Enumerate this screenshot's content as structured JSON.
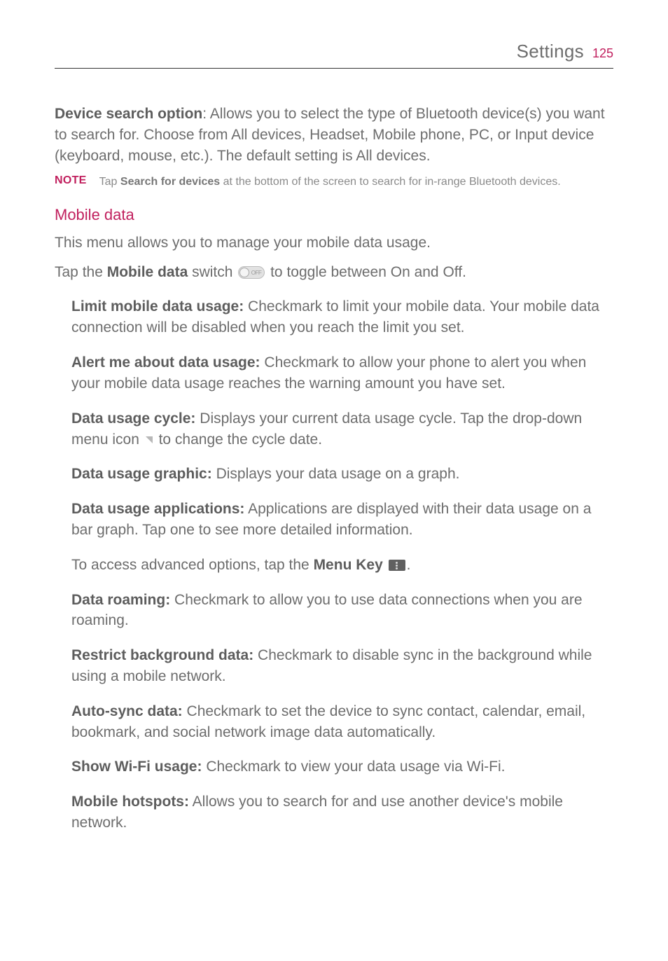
{
  "header": {
    "title": "Settings",
    "page": "125"
  },
  "p1": {
    "bold": "Device search option",
    "text": ": Allows you to select the type of Bluetooth device(s) you want to search for. Choose from All devices, Headset, Mobile phone, PC, or Input device (keyboard, mouse, etc.). The default setting is All devices."
  },
  "note1": {
    "label": "NOTE",
    "pre": "Tap ",
    "bold": "Search for devices",
    "post": " at the bottom of the screen to search for in-range Bluetooth devices."
  },
  "section1": {
    "title": "Mobile data"
  },
  "p2": "This menu allows you to manage your mobile data usage.",
  "p3": {
    "pre": "Tap the ",
    "bold": "Mobile data",
    "mid": " switch ",
    "post": " to toggle between On and Off."
  },
  "limit": {
    "bold": "Limit mobile data usage:",
    "text": " Checkmark to limit your mobile data. Your mobile data connection will be disabled when you reach the limit you set."
  },
  "alert": {
    "bold": "Alert me about data usage:",
    "text": " Checkmark to allow your phone to alert you when your mobile data usage reaches the warning amount you have set."
  },
  "cycle": {
    "bold": "Data usage cycle:",
    "pre": " Displays your current data usage cycle. Tap the drop-down menu icon ",
    "post": " to change the cycle date."
  },
  "graphic": {
    "bold": "Data usage graphic:",
    "text": " Displays your data usage on a graph."
  },
  "apps": {
    "bold": "Data usage applications:",
    "text": " Applications are displayed with their data usage on a bar graph. Tap one to see more detailed information."
  },
  "advanced": {
    "pre": "To access advanced options, tap the ",
    "bold": "Menu Key",
    "post": "."
  },
  "roaming": {
    "bold": "Data roaming:",
    "text": " Checkmark to allow you to use data connections when you are roaming."
  },
  "restrict": {
    "bold": "Restrict background data:",
    "text": " Checkmark to disable sync in the background while using a mobile network."
  },
  "autosync": {
    "bold": "Auto-sync data:",
    "text": " Checkmark to set the device to sync contact, calendar, email, bookmark, and social network image data automatically."
  },
  "wifi": {
    "bold": "Show Wi-Fi usage:",
    "text": " Checkmark to view your data usage via Wi-Fi."
  },
  "hotspot": {
    "bold": "Mobile hotspots:",
    "text": " Allows you to search for and use another device's mobile network."
  }
}
